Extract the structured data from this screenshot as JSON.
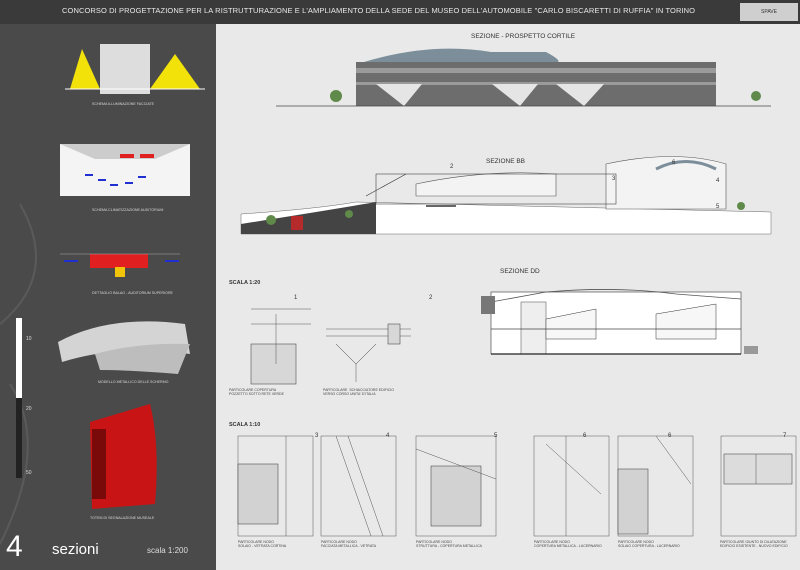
{
  "header": {
    "title": "CONCORSO  DI PROGETTAZIONE PER LA RISTRUTTURAZIONE E L'AMPLIAMENTO DELLA SEDE DEL MUSEO DELL'AUTOMOBILE \"CARLO BISCARETTI DI RUFFIA\" IN  TORINO",
    "tag": "SPAVE"
  },
  "left": {
    "captions": [
      "SCHEMA ILLUMINAZIONE FACCIATE",
      "SCHEMA CLIMATIZZAZIONE AUDITORIUM",
      "DETTAGLIO BALAO - AUDITORIUM SUPERIORE",
      "MODELLO METALLICO DELLE SCHERMO",
      "TOTEM DI SEGNALAZIONE MUSEALE"
    ],
    "big_number": "4",
    "big_word": "sezioni",
    "scale": "scala 1:200",
    "ticks": [
      "10",
      "20",
      "50"
    ]
  },
  "sheet": {
    "section_a": "SEZIONE - PROSPETTO  CORTILE",
    "section_b": "SEZIONE  BB",
    "section_d": "SEZIONE  DD",
    "scale_20": "SCALA 1:20",
    "scale_10": "SCALA 1:10",
    "detail_numbers_top": [
      "1",
      "2"
    ],
    "detail_numbers_bottom": [
      "3",
      "4",
      "5",
      "6",
      "6",
      "7"
    ],
    "section_b_marks": [
      "2",
      "3",
      "4",
      "5",
      "6"
    ],
    "captions_top": [
      "PARTICOLARE COPERTURA\nPOZZETTO SOTTO RETE VERDE",
      "PARTICOLARE  SCHIACCIATORE EDIFICIO\nVERSO CORSO UNITA' D'ITALIA"
    ],
    "captions_bottom": [
      "PARTICOLARE NODO\nSOLAIO - VETRATA CORTINA",
      "PARTICOLARE NODO\nFACCIATA METALLICA - VETRATA",
      "PARTICOLARE NODO\nSTRUTTURA - COPERTURA METALLICA",
      "PARTICOLARE NODO\nCOPERTURA METALLICA - LUCERNARIO",
      "PARTICOLARE NODO\nSOLAIO COPERTURA - LUCERNARIO",
      "PARTICOLARE GIUNTO DI DILATAZIONE\nEDIFICIO ESISTENTE - NUOVO EDIFICIO"
    ]
  }
}
